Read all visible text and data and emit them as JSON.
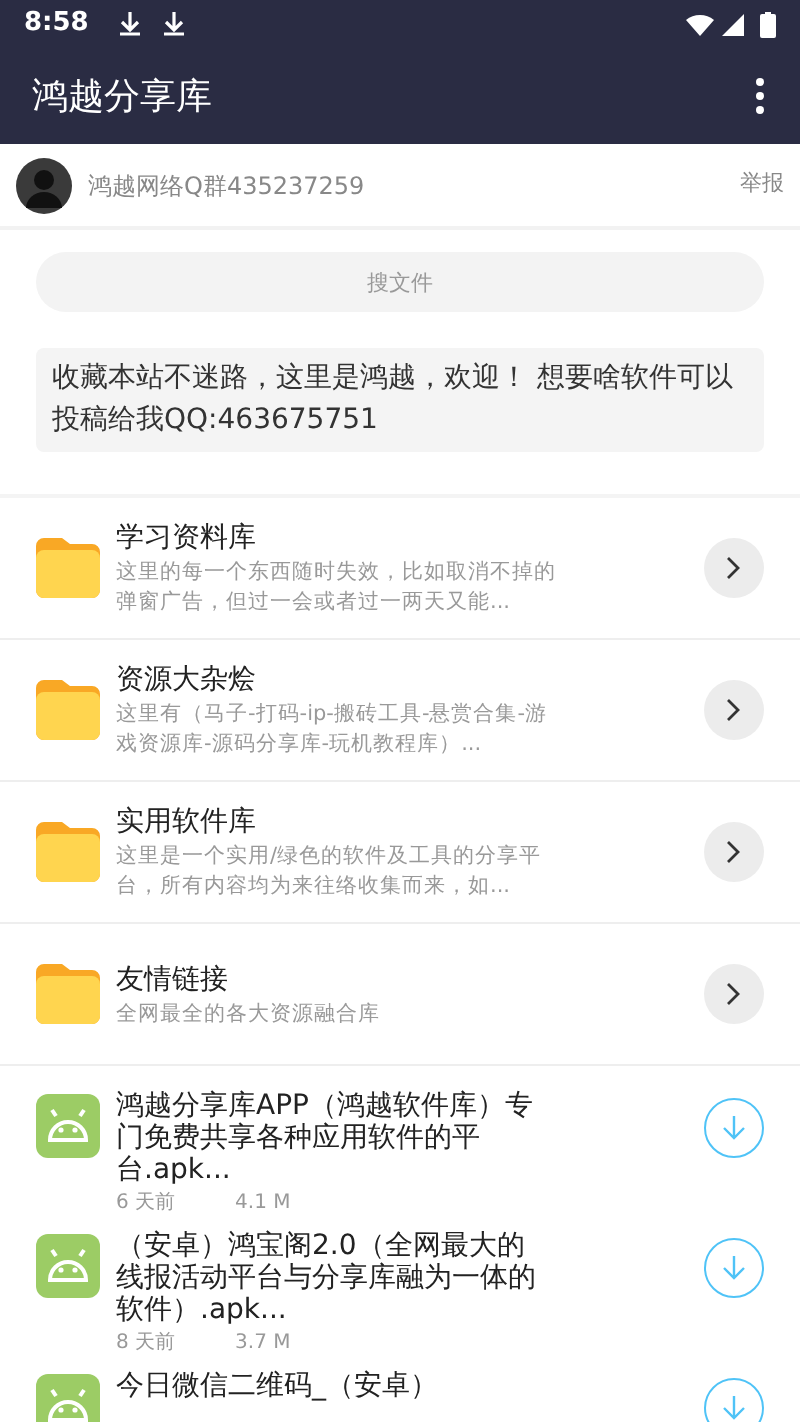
{
  "status_bar": {
    "time": "8:58"
  },
  "app_bar": {
    "title": "鸿越分享库"
  },
  "header": {
    "name": "鸿越网络Q群435237259",
    "report": "举报"
  },
  "search": {
    "placeholder": "搜文件"
  },
  "notice": "收藏本站不迷路，这里是鸿越，欢迎！ 想要啥软件可以投稿给我QQ:463675751",
  "folders": [
    {
      "title": "学习资料库",
      "description": "这里的每一个东西随时失效，比如取消不掉的弹窗广告，但过一会或者过一两天又能..."
    },
    {
      "title": "资源大杂烩",
      "description": "这里有（马子-打码-ip-搬砖工具-悬赏合集-游戏资源库-源码分享库-玩机教程库）..."
    },
    {
      "title": "实用软件库",
      "description": "这里是一个实用/绿色的软件及工具的分享平台，所有内容均为来往络收集而来，如..."
    },
    {
      "title": "友情链接",
      "description": "全网最全的各大资源融合库"
    }
  ],
  "files": [
    {
      "name": "鸿越分享库APP（鸿越软件库）专门免费共享各种应用软件的平台.apk...",
      "age": "6 天前",
      "size": "4.1 M"
    },
    {
      "name": "（安卓）鸿宝阁2.0（全网最大的线报活动平台与分享库融为一体的软件）.apk...",
      "age": "8 天前",
      "size": "3.7 M"
    },
    {
      "name": "今日微信二维码_（安卓）"
    }
  ]
}
